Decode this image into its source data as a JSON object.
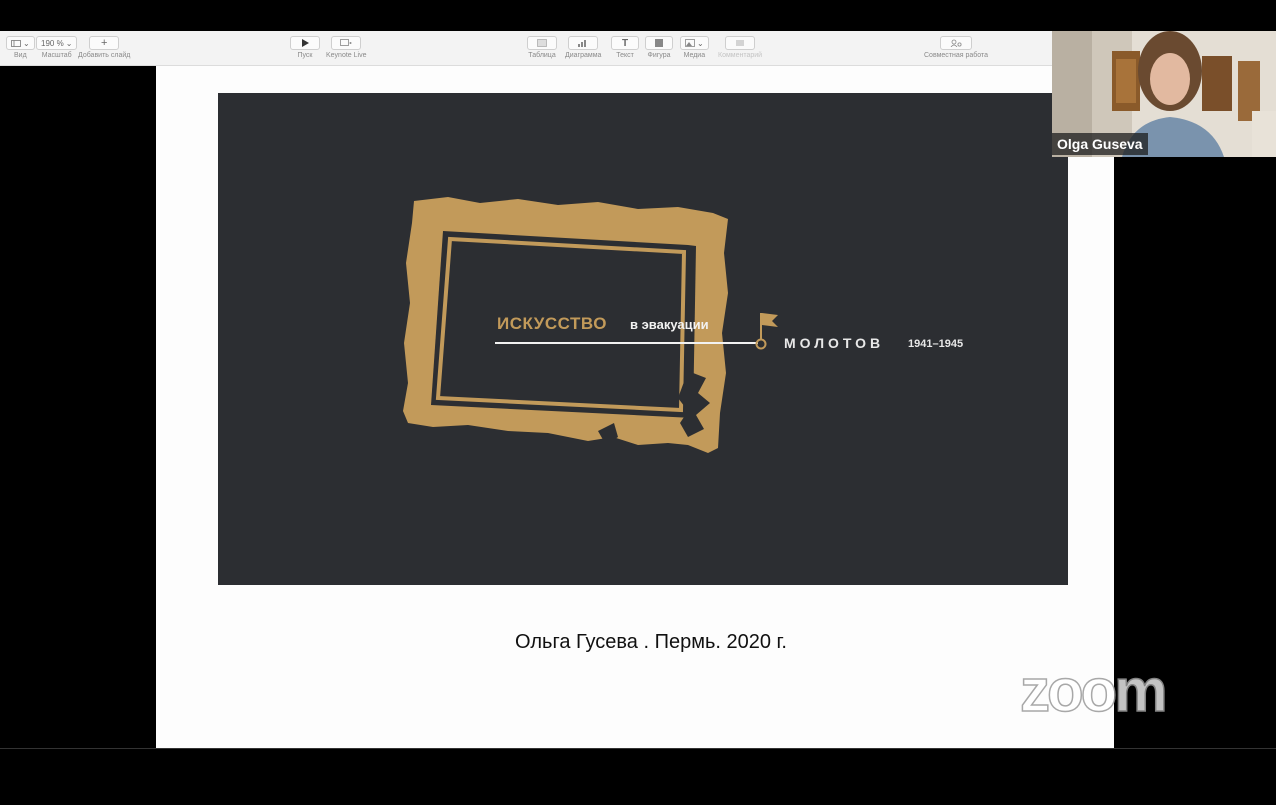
{
  "toolbar": {
    "view": {
      "label": "Вид"
    },
    "zoom": {
      "value": "190 %",
      "label": "Масштаб"
    },
    "add_slide": {
      "label": "Добавить слайд"
    },
    "play": {
      "label": "Пуск"
    },
    "keynote_live": {
      "label": "Keynote Live"
    },
    "table": {
      "label": "Таблица"
    },
    "chart": {
      "label": "Диаграмма"
    },
    "text": {
      "label": "Текст"
    },
    "shape": {
      "label": "Фигура"
    },
    "media": {
      "label": "Медиа"
    },
    "comment": {
      "label": "Комментарий"
    },
    "collaborate": {
      "label": "Совместная работа"
    }
  },
  "slide": {
    "logo": {
      "title_main": "ИСКУССТВО",
      "title_sub": "в эвакуации",
      "place": "МОЛОТОВ",
      "years": "1941–1945"
    },
    "caption": "Ольга Гусева . Пермь. 2020 г."
  },
  "participant": {
    "name": "Olga Guseva"
  },
  "watermark": {
    "text": "zoom"
  },
  "colors": {
    "slide_bg": "#2c2e32",
    "frame_gold": "#c29a5a",
    "canvas_bg": "#fdfdfd",
    "toolbar_bg": "#f3f3f3"
  }
}
